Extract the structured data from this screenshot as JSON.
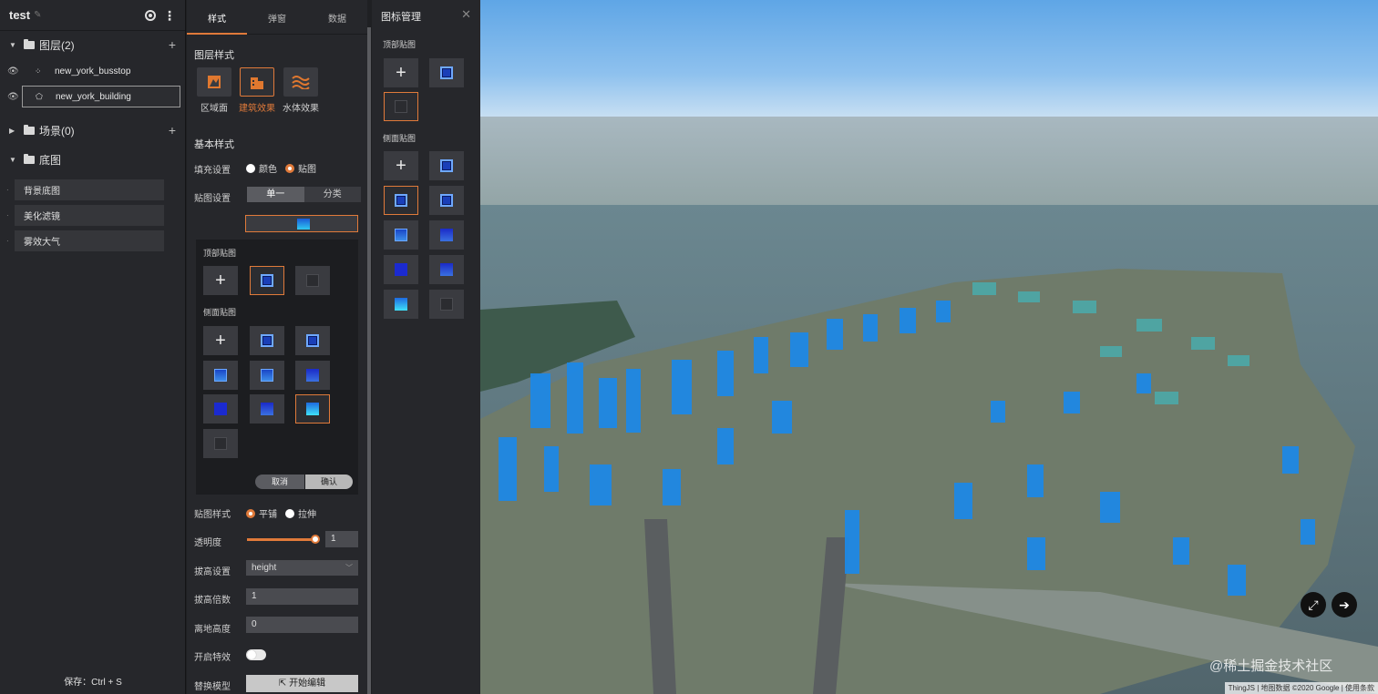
{
  "project": {
    "title": "test"
  },
  "left": {
    "layers": {
      "label": "图层(2)"
    },
    "layer_items": [
      "new_york_busstop",
      "new_york_building"
    ],
    "scenes": {
      "label": "场景(0)"
    },
    "basemap": {
      "label": "底图"
    },
    "basemap_items": [
      "背景底图",
      "美化滤镜",
      "雾效大气"
    ],
    "save_hint": "保存：Ctrl + S"
  },
  "mid": {
    "tabs": [
      "样式",
      "弹窗",
      "数据"
    ],
    "layer_style_title": "图层样式",
    "style_options": [
      "区域面",
      "建筑效果",
      "水体效果"
    ],
    "basic_style_title": "基本样式",
    "fill_label": "填充设置",
    "fill_options": [
      "颜色",
      "贴图"
    ],
    "texture_label": "贴图设置",
    "texture_segments": [
      "单一",
      "分类"
    ],
    "top_texture_title": "顶部贴图",
    "side_texture_title": "侧面贴图",
    "cancel": "取消",
    "confirm": "确认",
    "tex_style_label": "贴图样式",
    "tex_style_options": [
      "平铺",
      "拉伸"
    ],
    "opacity_label": "透明度",
    "opacity_value": "1",
    "extrude_label": "拔高设置",
    "extrude_value": "height",
    "extrude_mult_label": "拔高倍数",
    "extrude_mult_value": "1",
    "ground_height_label": "离地高度",
    "ground_height_value": "0",
    "effect_label": "开启特效",
    "replace_model_label": "替换模型",
    "start_edit": "开始编辑"
  },
  "icon_panel": {
    "title": "图标管理",
    "top_title": "顶部贴图",
    "side_title": "侧面贴图"
  },
  "view": {
    "watermark": "@稀土掘金技术社区",
    "attribution": "ThingJS | 地图数据 ©2020 Google | 使用条款"
  }
}
